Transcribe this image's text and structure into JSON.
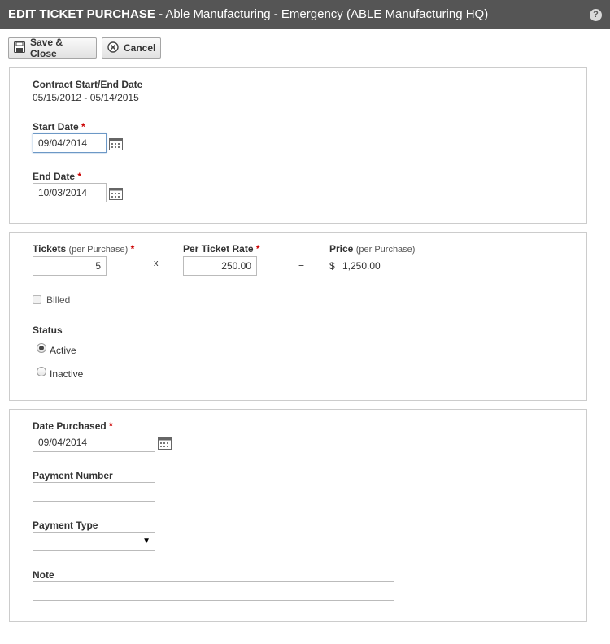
{
  "window": {
    "title_prefix": "EDIT TICKET PURCHASE -",
    "title_rest": " Able Manufacturing - Emergency (ABLE Manufacturing HQ)",
    "help_glyph": "?"
  },
  "toolbar": {
    "save_label": "Save & Close",
    "cancel_label": "Cancel"
  },
  "contract": {
    "label": "Contract Start/End Date",
    "value": "05/15/2012 - 05/14/2015"
  },
  "start_date": {
    "label": "Start Date",
    "value": "09/04/2014"
  },
  "end_date": {
    "label": "End Date",
    "value": "10/03/2014"
  },
  "tickets": {
    "label": "Tickets",
    "sub": "(per Purchase)",
    "value": "5"
  },
  "rate": {
    "label": "Per Ticket Rate",
    "value": "250.00"
  },
  "price": {
    "label": "Price",
    "sub": "(per Purchase)",
    "currency": "$",
    "value": "1,250.00"
  },
  "operators": {
    "multiply": "x",
    "equals": "="
  },
  "billed": {
    "label": "Billed",
    "checked": false
  },
  "status": {
    "label": "Status",
    "options": [
      "Active",
      "Inactive"
    ],
    "selected": "Active"
  },
  "date_purchased": {
    "label": "Date Purchased",
    "value": "09/04/2014"
  },
  "payment_number": {
    "label": "Payment Number",
    "value": ""
  },
  "payment_type": {
    "label": "Payment Type",
    "value": ""
  },
  "note": {
    "label": "Note",
    "value": ""
  },
  "required_marker": "*",
  "colors": {
    "titlebar": "#555555",
    "required": "#cc0000",
    "focus_border": "#6c98c6",
    "panel_border": "#cccccc"
  }
}
